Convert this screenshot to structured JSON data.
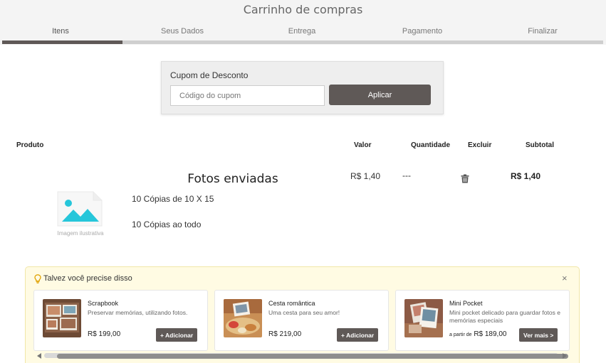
{
  "header": {
    "title": "Carrinho de compras"
  },
  "steps": [
    {
      "label": "Itens",
      "active": true
    },
    {
      "label": "Seus Dados",
      "active": false
    },
    {
      "label": "Entrega",
      "active": false
    },
    {
      "label": "Pagamento",
      "active": false
    },
    {
      "label": "Finalizar",
      "active": false
    }
  ],
  "progress": {
    "completed_steps": 1,
    "total_steps": 5
  },
  "coupon": {
    "label": "Cupom de Desconto",
    "placeholder": "Código do cupom",
    "value": "",
    "button_label": "Aplicar"
  },
  "table": {
    "headers": {
      "product": "Produto",
      "value": "Valor",
      "quantity": "Quantidade",
      "remove": "Excluir",
      "subtotal": "Subtotal"
    },
    "rows": [
      {
        "name": "Fotos enviadas",
        "image_caption": "Imagem ilustrativa",
        "details": [
          "10 Cópias de 10 X 15",
          "10 Cópias ao todo"
        ],
        "value": "R$ 1,40",
        "quantity": "---",
        "remove_icon": "trash-icon",
        "subtotal": "R$ 1,40"
      }
    ]
  },
  "suggestions": {
    "title": "Talvez você precise disso",
    "close_label": "×",
    "items": [
      {
        "name": "Scrapbook",
        "description": "Preservar memórias, utilizando fotos.",
        "price_prefix": "",
        "price": "R$ 199,00",
        "button_label": "+ Adicionar"
      },
      {
        "name": "Cesta romântica",
        "description": "Uma cesta para seu amor!",
        "price_prefix": "",
        "price": "R$ 219,00",
        "button_label": "+ Adicionar"
      },
      {
        "name": "Mini Pocket",
        "description": "Mini pocket delicado para guardar fotos e memórias especiais",
        "price_prefix": "a partir de",
        "price": "R$ 189,00",
        "button_label": "Ver mais >"
      }
    ]
  },
  "colors": {
    "accent": "#5f5957",
    "image_placeholder": "#26c6da",
    "suggest_bg": "#fffbe3"
  }
}
